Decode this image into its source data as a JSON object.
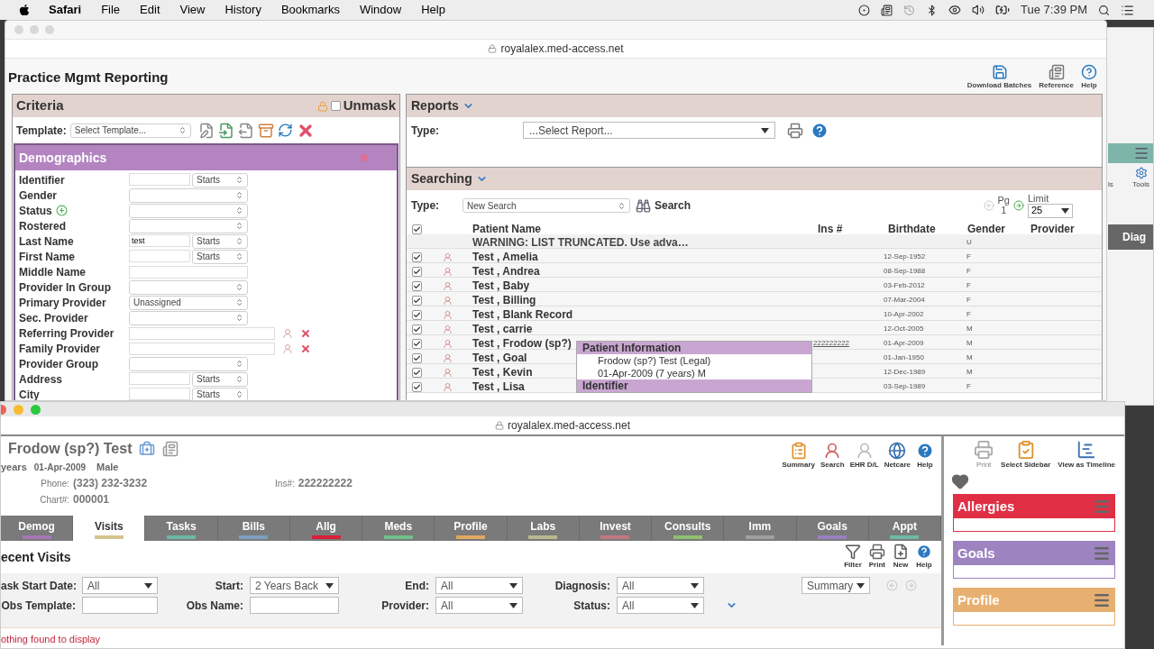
{
  "menu": {
    "app": "Safari",
    "items": [
      "File",
      "Edit",
      "View",
      "History",
      "Bookmarks",
      "Window",
      "Help"
    ],
    "clock": "Tue 7:39 PM"
  },
  "background_window": {
    "tool_labels": [
      "ls",
      "Tools"
    ],
    "tab": "Diag"
  },
  "top_window": {
    "url": "royalalex.med-access.net",
    "page_title": "Practice Mgmt Reporting",
    "toolbar": [
      "Download Batches",
      "Reference",
      "Help"
    ],
    "criteria": {
      "title": "Criteria",
      "unmask": {
        "label": "Unmask",
        "checked": false
      },
      "template_label": "Template:",
      "template_select": "Select Template...",
      "section": "Demographics",
      "fields": [
        {
          "label": "Identifier",
          "kind": "text_match",
          "match": "Starts"
        },
        {
          "label": "Gender",
          "kind": "select"
        },
        {
          "label": "Status",
          "kind": "select_add"
        },
        {
          "label": "Rostered",
          "kind": "select"
        },
        {
          "label": "Last Name",
          "kind": "text_match",
          "value": "test",
          "match": "Starts"
        },
        {
          "label": "First Name",
          "kind": "text_match",
          "match": "Starts"
        },
        {
          "label": "Middle Name",
          "kind": "text"
        },
        {
          "label": "Provider In Group",
          "kind": "select"
        },
        {
          "label": "Primary Provider",
          "kind": "select",
          "value": "Unassigned"
        },
        {
          "label": "Sec. Provider",
          "kind": "select"
        },
        {
          "label": "Referring Provider",
          "kind": "lookup"
        },
        {
          "label": "Family Provider",
          "kind": "lookup"
        },
        {
          "label": "Provider Group",
          "kind": "select"
        },
        {
          "label": "Address",
          "kind": "text_match",
          "match": "Starts"
        },
        {
          "label": "City",
          "kind": "text_match",
          "match": "Starts"
        }
      ]
    },
    "reports": {
      "title": "Reports",
      "type_label": "Type:",
      "select": "...Select Report..."
    },
    "searching": {
      "title": "Searching",
      "type_label": "Type:",
      "select": "New Search",
      "search_button": "Search",
      "page_label": "Pg",
      "page": "1",
      "limit_label": "Limit",
      "limit": "25",
      "all_checked": true,
      "columns": [
        "Patient Name",
        "Ins #",
        "Birthdate",
        "Gender",
        "Provider"
      ],
      "rows": [
        {
          "kind": "warning",
          "name": "WARNING: LIST TRUNCATED. Use adva…",
          "gender": "U"
        },
        {
          "kind": "patient",
          "checked": true,
          "name": "Test , Amelia",
          "birthdate": "12-Sep-1952",
          "gender": "F"
        },
        {
          "kind": "patient",
          "checked": true,
          "name": "Test , Andrea",
          "birthdate": "08-Sep-1988",
          "gender": "F"
        },
        {
          "kind": "patient",
          "checked": true,
          "name": "Test , Baby",
          "birthdate": "03-Feb-2012",
          "gender": "F"
        },
        {
          "kind": "patient",
          "checked": true,
          "name": "Test , Billing",
          "birthdate": "07-Mar-2004",
          "gender": "F"
        },
        {
          "kind": "patient",
          "checked": true,
          "name": "Test , Blank Record",
          "birthdate": "10-Apr-2002",
          "gender": "F"
        },
        {
          "kind": "patient",
          "checked": true,
          "name": "Test , carrie",
          "birthdate": "12-Oct-2005",
          "gender": "M"
        },
        {
          "kind": "patient",
          "checked": true,
          "name": "Test , Frodow (sp?)",
          "ins": "222222222",
          "birthdate": "01-Apr-2009",
          "gender": "M"
        },
        {
          "kind": "patient",
          "checked": true,
          "name": "Test , Goal",
          "birthdate": "01-Jan-1950",
          "gender": "M"
        },
        {
          "kind": "patient",
          "checked": true,
          "name": "Test , Kevin",
          "birthdate": "12-Dec-1989",
          "gender": "M"
        },
        {
          "kind": "patient",
          "checked": true,
          "name": "Test , Lisa",
          "birthdate": "03-Sep-1989",
          "gender": "F"
        }
      ],
      "popup": [
        {
          "title": "Patient Information",
          "lines": [
            "Frodow (sp?) Test (Legal)",
            "01-Apr-2009 (7 years) M"
          ]
        },
        {
          "title": "Identifier"
        }
      ]
    }
  },
  "bottom_window": {
    "url": "royalalex.med-access.net",
    "patient": {
      "name": "Frodow (sp?) Test",
      "age": "years",
      "birthdate": "01-Apr-2009",
      "sex": "Male",
      "phone_label": "Phone:",
      "phone": "(323) 232-3232",
      "ins_label": "Ins#:",
      "ins": "222222222",
      "chart_label": "Chart#:",
      "chart": "000001"
    },
    "header_tools": [
      "Summary",
      "Search",
      "EHR D/L",
      "Netcare",
      "Help"
    ],
    "tabs": [
      {
        "label": "Demog",
        "selected": false,
        "color": "#a678b8"
      },
      {
        "label": "Visits",
        "selected": true,
        "color": "#d4c48a"
      },
      {
        "label": "Tasks",
        "selected": false,
        "color": "#6fb8a8"
      },
      {
        "label": "Bills",
        "selected": false,
        "color": "#7f9fc0"
      },
      {
        "label": "Allg",
        "selected": false,
        "color": "#d8203a"
      },
      {
        "label": "Meds",
        "selected": false,
        "color": "#6fc08a"
      },
      {
        "label": "Profile",
        "selected": false,
        "color": "#e0a860"
      },
      {
        "label": "Labs",
        "selected": false,
        "color": "#b8b890"
      },
      {
        "label": "Invest",
        "selected": false,
        "color": "#c07880"
      },
      {
        "label": "Consults",
        "selected": false,
        "color": "#8fc070"
      },
      {
        "label": "Imm",
        "selected": false,
        "color": "#a0a0a0"
      },
      {
        "label": "Goals",
        "selected": false,
        "color": "#9a7fc0"
      },
      {
        "label": "Appt",
        "selected": false,
        "color": "#70b8a8"
      }
    ],
    "section_title": "ecent Visits",
    "list_tools": [
      "Filter",
      "Print",
      "New",
      "Help"
    ],
    "filters": [
      {
        "label": "ask Start Date:",
        "kind": "select",
        "value": "All"
      },
      {
        "label": "Start:",
        "kind": "select",
        "value": "2 Years Back"
      },
      {
        "label": "End:",
        "kind": "select",
        "value": "All"
      },
      {
        "label": "Diagnosis:",
        "kind": "select",
        "value": "All"
      },
      {
        "label": "Obs Template:",
        "kind": "text"
      },
      {
        "label": "Obs Name:",
        "kind": "text"
      },
      {
        "label": "Provider:",
        "kind": "select",
        "value": "All"
      },
      {
        "label": "Status:",
        "kind": "select",
        "value": "All"
      }
    ],
    "view_select": "Summary",
    "message": "othing found to display",
    "sidebar": {
      "tools": [
        "Print",
        "Select Sidebar",
        "View as Timeline"
      ],
      "cards": [
        {
          "title": "Allergies",
          "color": "#e02f45"
        },
        {
          "title": "Goals",
          "color": "#9d83c0"
        },
        {
          "title": "Profile",
          "color": "#e8b070"
        }
      ]
    }
  }
}
